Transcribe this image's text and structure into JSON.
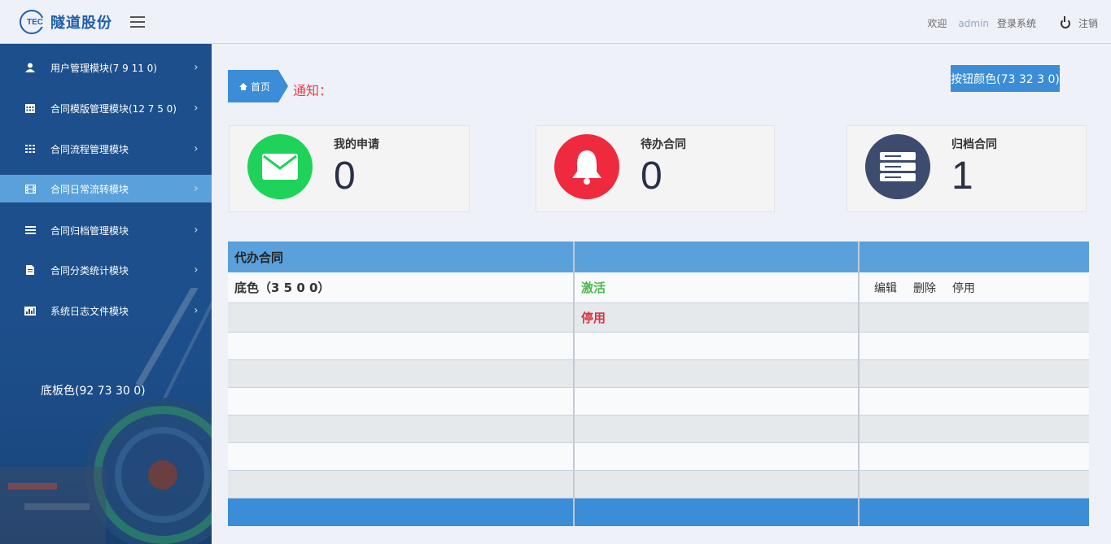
{
  "header": {
    "logo_mark": "TEC",
    "logo_text": "隧道股份",
    "welcome": "欢迎",
    "user": "admin",
    "system": "登录系统",
    "logout": "注销"
  },
  "sidebar": {
    "items": [
      {
        "label": "用户管理模块(7 9 11 0)",
        "icon": "user-icon"
      },
      {
        "label": "合同模版管理模块(12 7 5 0)",
        "icon": "calendar-icon"
      },
      {
        "label": "合同流程管理模块",
        "icon": "grid-icon"
      },
      {
        "label": "合同日常流转模块",
        "icon": "film-icon"
      },
      {
        "label": "合同归档管理模块",
        "icon": "list-icon"
      },
      {
        "label": "合同分类统计模块",
        "icon": "file-icon"
      },
      {
        "label": "系统日志文件模块",
        "icon": "chart-icon"
      }
    ],
    "base_color_note": "底板色(92 73 30 0)",
    "chevron": "›"
  },
  "breadcrumb": {
    "home": "首页"
  },
  "notice": "通知：",
  "color_button": "按钮颜色(73 32 3 0)",
  "colors": {
    "primary": "#3a8dd6",
    "green": "#1fd35a",
    "red": "#ef2a3e",
    "navy": "#3c4b6e",
    "sidebar": "#1d4f8c"
  },
  "cards": [
    {
      "title": "我的申请",
      "count": "0",
      "icon": "mail-icon"
    },
    {
      "title": "待办合同",
      "count": "0",
      "icon": "bell-icon"
    },
    {
      "title": "归档合同",
      "count": "1",
      "icon": "server-icon"
    }
  ],
  "table": {
    "header": "代办合同",
    "row1": {
      "name": "底色（3 5 0 0）",
      "status": "激活",
      "actions": [
        "编辑",
        "删除",
        "停用"
      ]
    },
    "row2": {
      "status": "停用"
    }
  }
}
